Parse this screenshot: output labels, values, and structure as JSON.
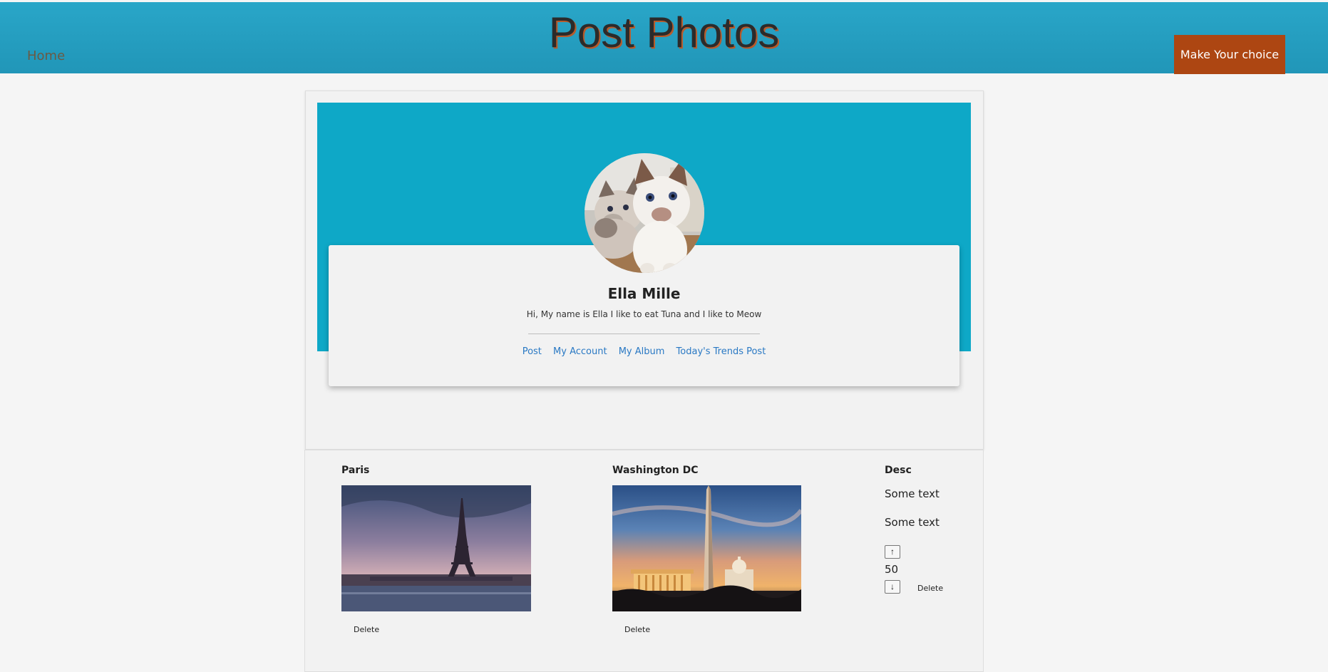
{
  "header": {
    "home_label": "Home",
    "title": "Post Photos",
    "choice_button": "Make Your choice"
  },
  "profile": {
    "name": "Ella Mille",
    "bio": "Hi, My name is Ella I like to eat Tuna and I like to Meow",
    "nav": [
      "Post",
      "My Account",
      "My Album",
      "Today's Trends Post"
    ],
    "avatar": "cat-kittens-photo"
  },
  "posts": [
    {
      "title": "Paris",
      "photo": "eiffel-tower-photo",
      "delete_label": "Delete"
    },
    {
      "title": "Washington DC",
      "photo": "washington-monument-photo",
      "delete_label": "Delete"
    }
  ],
  "desc": {
    "title": "Desc",
    "lines": [
      "Some text",
      "Some text"
    ],
    "vote_count": "50",
    "up_icon": "arrow-up-icon",
    "down_icon": "arrow-down-icon",
    "delete_label": "Delete"
  },
  "colors": {
    "header_bg": "#2196b8",
    "cover_bg": "#0ea8c7",
    "choice_button_bg": "#ad4612",
    "link": "#2a79c4"
  }
}
